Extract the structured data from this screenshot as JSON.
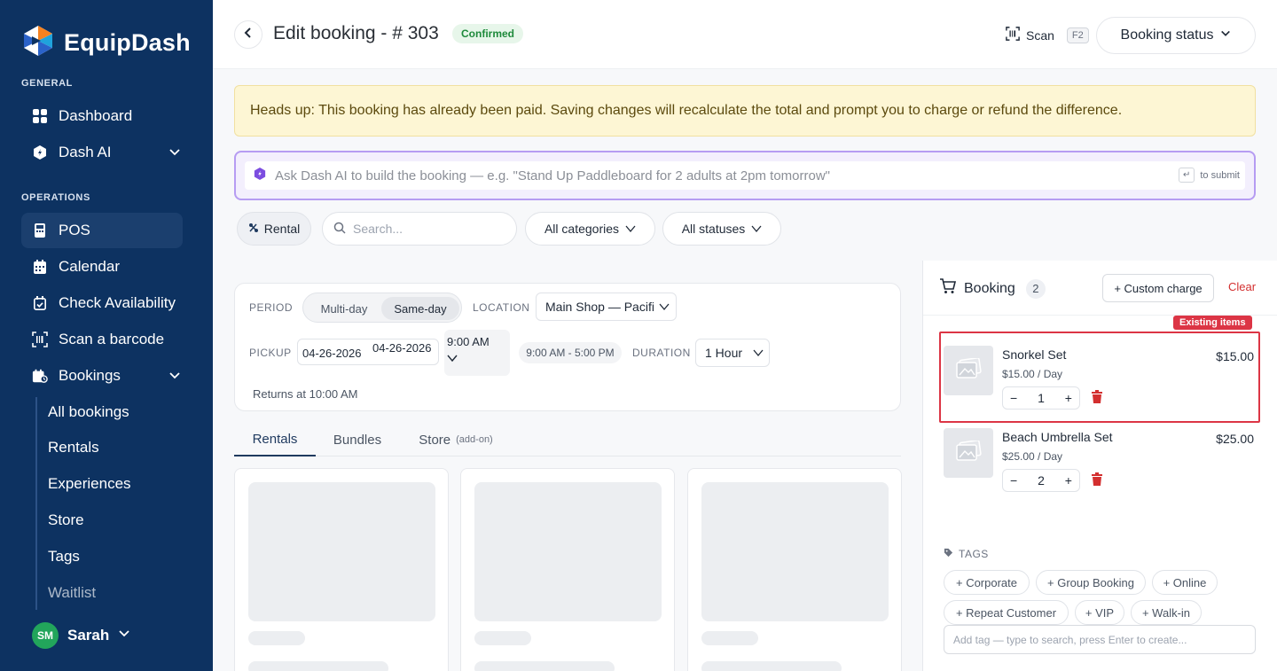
{
  "colors": {
    "sidebar_bg": "#0d3261",
    "sidebar_active": "#1b3f6e",
    "confirmed_green": "#1e8a3b",
    "alert_bg": "#fdf6d4",
    "ai_purple": "#b69cf2",
    "danger_red": "#dc3545",
    "avatar_green": "#22a55b"
  },
  "brand": {
    "name": "EquipDash",
    "logo_icon": "equipdash-logo-icon"
  },
  "sidebar": {
    "general_label": "GENERAL",
    "dashboard": "Dashboard",
    "dash_ai": "Dash AI",
    "operations_label": "OPERATIONS",
    "pos": "POS",
    "calendar": "Calendar",
    "check_availability": "Check Availability",
    "scan_barcode": "Scan a barcode",
    "bookings": "Bookings",
    "sub_items": [
      "All bookings",
      "Rentals",
      "Experiences",
      "Store",
      "Tags",
      "Waitlist"
    ],
    "active_item": "POS"
  },
  "user": {
    "initials": "SM",
    "name": "Sarah"
  },
  "header": {
    "title": "Edit booking - # 303",
    "status_badge": "Confirmed",
    "scan_label": "Scan",
    "scan_shortcut": "F2",
    "booking_status_label": "Booking status"
  },
  "alert": {
    "text": "Heads up: This booking has already been paid. Saving changes will recalculate the total and prompt you to charge or refund the difference."
  },
  "ai_bar": {
    "placeholder": "Ask Dash AI to build the booking — e.g. \"Stand Up Paddleboard for 2 adults at 2pm tomorrow\"",
    "enter_key": "↵",
    "submit_hint": "to submit"
  },
  "filters": {
    "rental_pill": "Rental",
    "search_placeholder": "Search...",
    "categories": "All categories",
    "statuses": "All statuses"
  },
  "period": {
    "period_label": "PERIOD",
    "multi_day": "Multi-day",
    "same_day": "Same-day",
    "selected": "Same-day",
    "location_label": "LOCATION",
    "location_value": "Main Shop — Pacifi",
    "pickup_label": "PICKUP",
    "pickup_date_1": "04-26-2026",
    "pickup_date_2": "04-26-2026",
    "pickup_time": "9:00 AM",
    "hours": "9:00 AM - 5:00 PM",
    "duration_label": "DURATION",
    "duration_value": "1 Hour",
    "returns_text": "Returns at 10:00 AM"
  },
  "tabs": {
    "rentals": "Rentals",
    "bundles": "Bundles",
    "store": "Store",
    "store_note": "(add-on)",
    "active": "Rentals"
  },
  "booking_panel": {
    "title": "Booking",
    "count": "2",
    "custom_charge": "+ Custom charge",
    "clear": "Clear",
    "existing_items_label": "Existing items",
    "items": [
      {
        "name": "Snorkel Set",
        "rate": "$15.00 / Day",
        "price": "$15.00",
        "qty": "1"
      },
      {
        "name": "Beach Umbrella Set",
        "rate": "$25.00 / Day",
        "price": "$25.00",
        "qty": "2"
      }
    ],
    "tags_label": "TAGS",
    "tags": [
      "+ Corporate",
      "+ Group Booking",
      "+ Online",
      "+ Repeat Customer",
      "+ VIP",
      "+ Walk-in"
    ],
    "tag_input_placeholder": "Add tag — type to search, press Enter to create..."
  }
}
